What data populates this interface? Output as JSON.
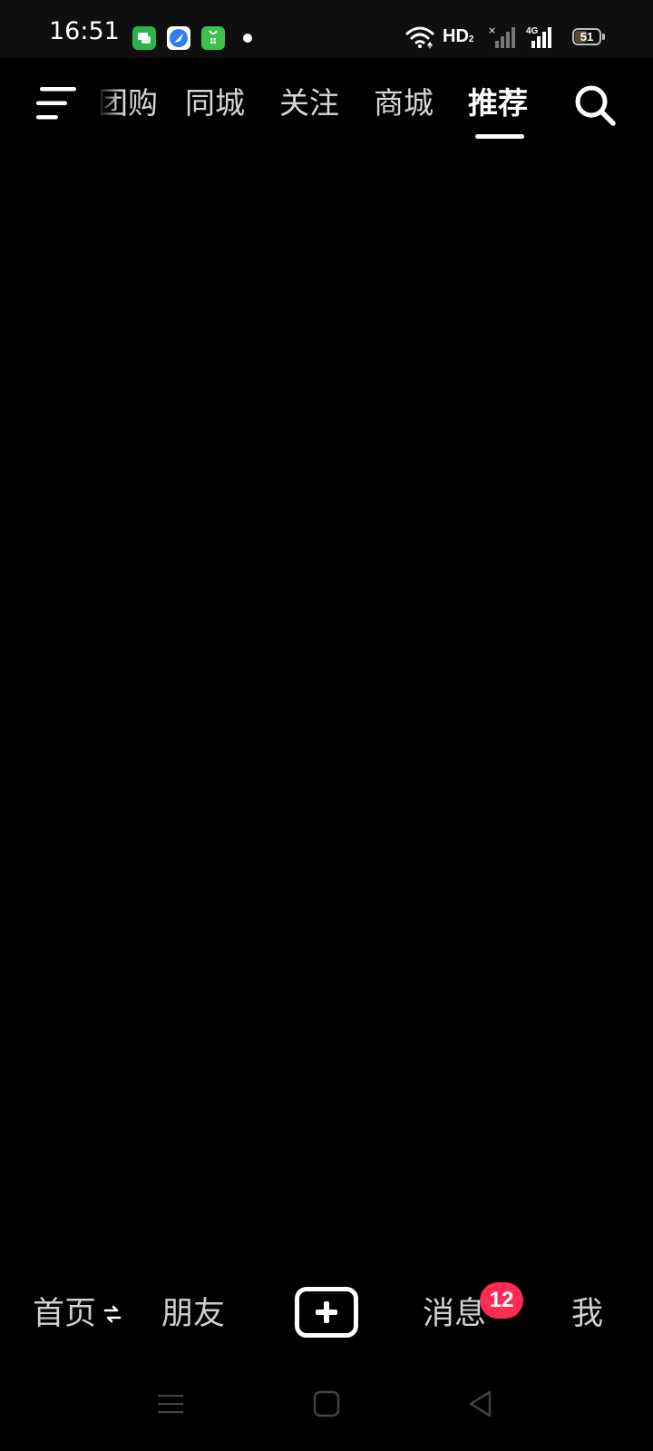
{
  "status_bar": {
    "time": "16:51",
    "notification_icons": [
      "messages-app-icon",
      "browser-app-icon",
      "store-app-icon"
    ],
    "network_label": "HD",
    "network_sub": "2",
    "cellular_label": "4G",
    "battery_level": "51",
    "battery_percent": 51
  },
  "top_nav": {
    "tabs": [
      {
        "label": "团购",
        "active": false
      },
      {
        "label": "同城",
        "active": false
      },
      {
        "label": "关注",
        "active": false
      },
      {
        "label": "商城",
        "active": false
      },
      {
        "label": "推荐",
        "active": true
      }
    ]
  },
  "bottom_nav": {
    "items": [
      {
        "label": "首页"
      },
      {
        "label": "朋友"
      },
      {
        "label": "消息",
        "badge": "12"
      },
      {
        "label": "我"
      }
    ]
  },
  "colors": {
    "background": "#000000",
    "badge": "#fe2c55",
    "active_text": "#ffffff",
    "inactive_text": "#d6d6d6"
  },
  "icons": {
    "menu": "hamburger-menu-icon",
    "search": "search-icon",
    "swap": "swap-arrows-icon",
    "create": "plus-icon"
  }
}
